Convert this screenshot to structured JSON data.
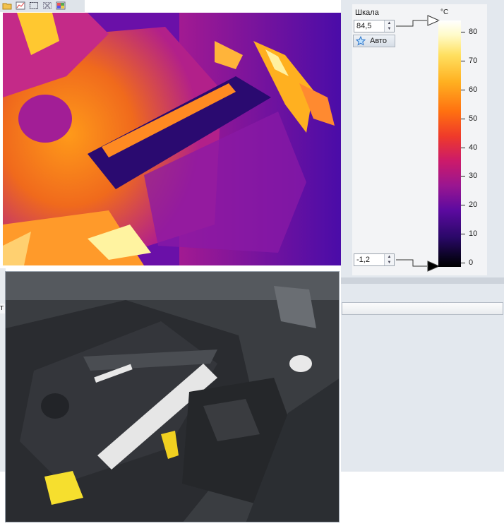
{
  "toolbar": {
    "icons": [
      "folder-icon",
      "chart-icon",
      "select-rect-icon",
      "delete-icon",
      "palette-icon"
    ]
  },
  "scale": {
    "label": "Шкала",
    "max_value": "84,5",
    "min_value": "-1,2",
    "auto_button_label": "Авто",
    "unit": "°C",
    "tick_labels": [
      "80",
      "70",
      "60",
      "50",
      "40",
      "30",
      "20",
      "10",
      "0"
    ],
    "max_value_num": 84.5,
    "min_value_num": -1.2
  },
  "left_tab_fragment": "т"
}
